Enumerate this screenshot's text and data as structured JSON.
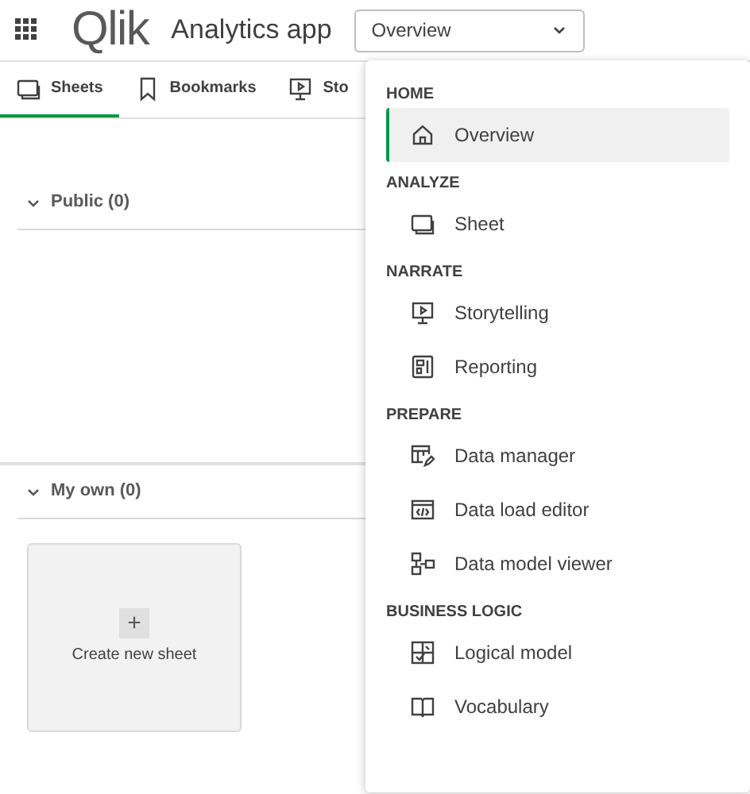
{
  "header": {
    "logo": "Qlik",
    "app_title": "Analytics app",
    "view_select": {
      "value": "Overview"
    }
  },
  "tabs": [
    {
      "label": "Sheets",
      "kind": "sheet",
      "selected": true
    },
    {
      "label": "Bookmarks",
      "kind": "bookmark",
      "selected": false
    },
    {
      "label": "Sto",
      "kind": "story",
      "selected": false
    }
  ],
  "sections": [
    {
      "title": "Public (0)",
      "expanded": true
    },
    {
      "title": "My own (0)",
      "expanded": true
    }
  ],
  "create_card": {
    "icon": "+",
    "label": "Create new sheet"
  },
  "menu": [
    {
      "title": "HOME",
      "items": [
        {
          "label": "Overview",
          "kind": "home",
          "selected": true
        }
      ]
    },
    {
      "title": "ANALYZE",
      "items": [
        {
          "label": "Sheet",
          "kind": "sheet",
          "selected": false
        }
      ]
    },
    {
      "title": "NARRATE",
      "items": [
        {
          "label": "Storytelling",
          "kind": "story",
          "selected": false
        },
        {
          "label": "Reporting",
          "kind": "report",
          "selected": false
        }
      ]
    },
    {
      "title": "PREPARE",
      "items": [
        {
          "label": "Data manager",
          "kind": "manager",
          "selected": false
        },
        {
          "label": "Data load editor",
          "kind": "code",
          "selected": false
        },
        {
          "label": "Data model viewer",
          "kind": "model",
          "selected": false
        }
      ]
    },
    {
      "title": "BUSINESS LOGIC",
      "items": [
        {
          "label": "Logical model",
          "kind": "logic",
          "selected": false
        },
        {
          "label": "Vocabulary",
          "kind": "book",
          "selected": false
        }
      ]
    }
  ]
}
